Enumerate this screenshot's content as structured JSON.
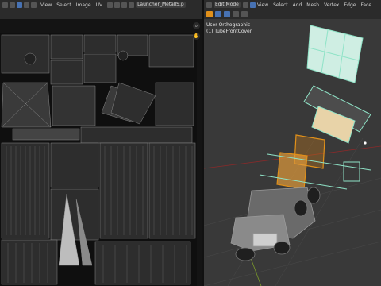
{
  "uv_editor": {
    "menu": [
      "View",
      "Select",
      "Image",
      "UV"
    ],
    "image_name": "Launcher_MetallS.p",
    "zoom_icon": "search-icon",
    "hand_icon": "hand-icon"
  },
  "viewport": {
    "mode": "Edit Mode",
    "menu": [
      "View",
      "Select",
      "Add",
      "Mesh",
      "Vertex",
      "Edge",
      "Face"
    ],
    "view_name": "User Orthographic",
    "object_name": "(1) TubeFrontCover",
    "colors": {
      "selected": "#e0901a",
      "active": "#ffffff",
      "accent": "#4772b3",
      "grid_line": "#8a2a2a",
      "axis_line": "#7a9a2a",
      "background": "#3a3a3a"
    }
  }
}
